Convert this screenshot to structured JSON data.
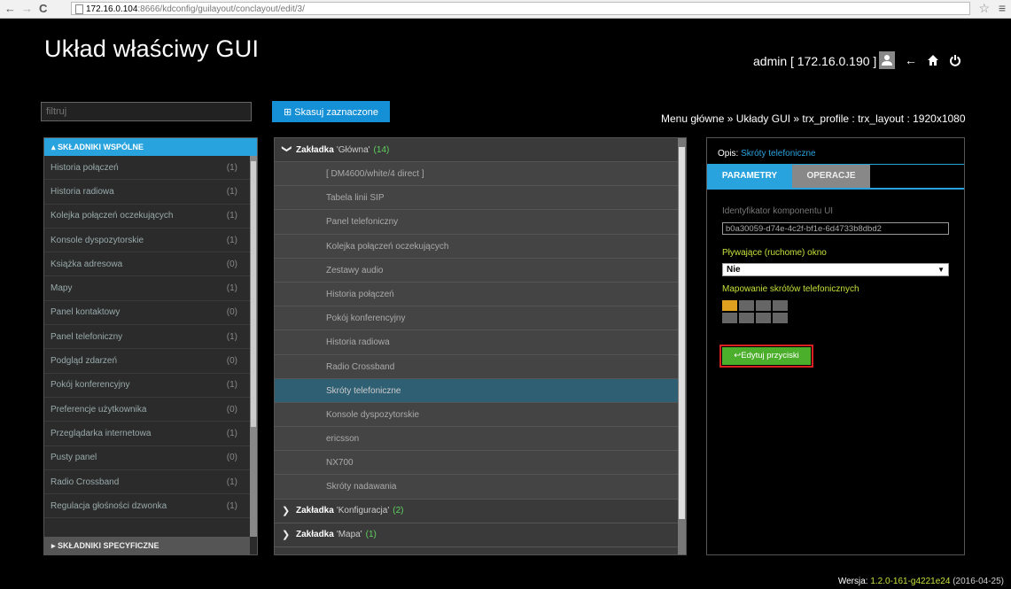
{
  "browser": {
    "back": "←",
    "forward": "→",
    "reload": "C",
    "url_host": "172.16.0.104",
    "url_path": ":8666/kdconfig/guilayout/conclayout/edit/3/",
    "star": "☆",
    "menu": "≡"
  },
  "header": {
    "title": "Układ właściwy GUI",
    "user": "admin [ 172.16.0.190 ]",
    "icons": [
      "user-icon",
      "back-arrow-icon",
      "home-icon",
      "power-icon"
    ]
  },
  "toolbar": {
    "filter_placeholder": "filtruj",
    "delete_label": "⊞ Skasuj zaznaczone",
    "breadcrumb": "Menu główne » Układy GUI » trx_profile : trx_layout : 1920x1080"
  },
  "left_panel": {
    "header": "▴ SKŁADNIKI WSPÓLNE",
    "items": [
      {
        "label": "Historia połączeń",
        "count": "(1)"
      },
      {
        "label": "Historia radiowa",
        "count": "(1)"
      },
      {
        "label": "Kolejka połączeń oczekujących",
        "count": "(1)"
      },
      {
        "label": "Konsole dyspozytorskie",
        "count": "(1)"
      },
      {
        "label": "Książka adresowa",
        "count": "(0)"
      },
      {
        "label": "Mapy",
        "count": "(1)"
      },
      {
        "label": "Panel kontaktowy",
        "count": "(0)"
      },
      {
        "label": "Panel telefoniczny",
        "count": "(1)"
      },
      {
        "label": "Podgląd zdarzeń",
        "count": "(0)"
      },
      {
        "label": "Pokój konferencyjny",
        "count": "(1)"
      },
      {
        "label": "Preferencje użytkownika",
        "count": "(0)"
      },
      {
        "label": "Przeglądarka internetowa",
        "count": "(1)"
      },
      {
        "label": "Pusty panel",
        "count": "(0)"
      },
      {
        "label": "Radio Crossband",
        "count": "(1)"
      },
      {
        "label": "Regulacja głośności dzwonka",
        "count": "(1)"
      }
    ],
    "footer": "▸ SKŁADNIKI SPECYFICZNE"
  },
  "middle_panel": {
    "tabs": [
      {
        "word": "Zakładka",
        "name": "'Główna'",
        "count": "(14)",
        "chevron": "❯"
      },
      {
        "word": "Zakładka",
        "name": "'Konfiguracja'",
        "count": "(2)",
        "chevron": "❯"
      },
      {
        "word": "Zakładka",
        "name": "'Mapa'",
        "count": "(1)",
        "chevron": "❯"
      }
    ],
    "items": [
      "[ DM4600/white/4 direct ]",
      "Tabela linii SIP",
      "Panel telefoniczny",
      "Kolejka połączeń oczekujących",
      "Zestawy audio",
      "Historia połączeń",
      "Pokój konferencyjny",
      "Historia radiowa",
      "Radio Crossband",
      "Skróty telefoniczne",
      "Konsole dyspozytorskie",
      "ericsson",
      "NX700",
      "Skróty nadawania"
    ],
    "selected_index": 9
  },
  "right_panel": {
    "opis_label": "Opis:",
    "opis_value": "Skróty telefoniczne",
    "tab_params": "PARAMETRY",
    "tab_ops": "OPERACJE",
    "id_label": "Identyfikator komponentu UI",
    "id_value": "b0a30059-d74e-4c2f-bf1e-6d4733b8dbd2",
    "floating_label": "Pływające (ruchome) okno",
    "floating_value": "Nie",
    "mapping_label": "Mapowanie skrótów telefonicznych",
    "edit_button": "↩Edytuj przyciski"
  },
  "footer": {
    "version_label": "Wersja:",
    "version_number": "1.2.0-161-g4221e24",
    "version_date": "(2016-04-25)"
  }
}
